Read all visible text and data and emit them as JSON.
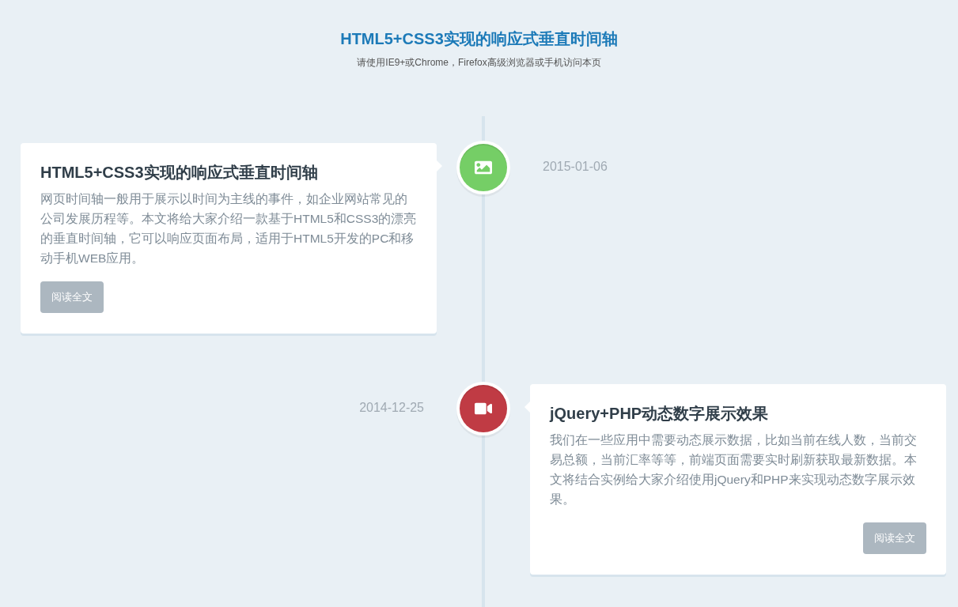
{
  "header": {
    "title": "HTML5+CSS3实现的响应式垂直时间轴",
    "subtitle": "请使用IE9+或Chrome，Firefox高级浏览器或手机访问本页"
  },
  "timeline": [
    {
      "kind": "image",
      "color": "#75ce66",
      "date": "2015-01-06",
      "title": "HTML5+CSS3实现的响应式垂直时间轴",
      "body": "网页时间轴一般用于展示以时间为主线的事件，如企业网站常见的公司发展历程等。本文将给大家介绍一款基于HTML5和CSS3的漂亮的垂直时间轴，它可以响应页面布局，适用于HTML5开发的PC和移动手机WEB应用。",
      "button": "阅读全文"
    },
    {
      "kind": "video",
      "color": "#c03b44",
      "date": "2014-12-25",
      "title": "jQuery+PHP动态数字展示效果",
      "body": "我们在一些应用中需要动态展示数据，比如当前在线人数，当前交易总额，当前汇率等等，前端页面需要实时刷新获取最新数据。本文将结合实例给大家介绍使用jQuery和PHP来实现动态数字展示效果。",
      "button": "阅读全文"
    }
  ]
}
